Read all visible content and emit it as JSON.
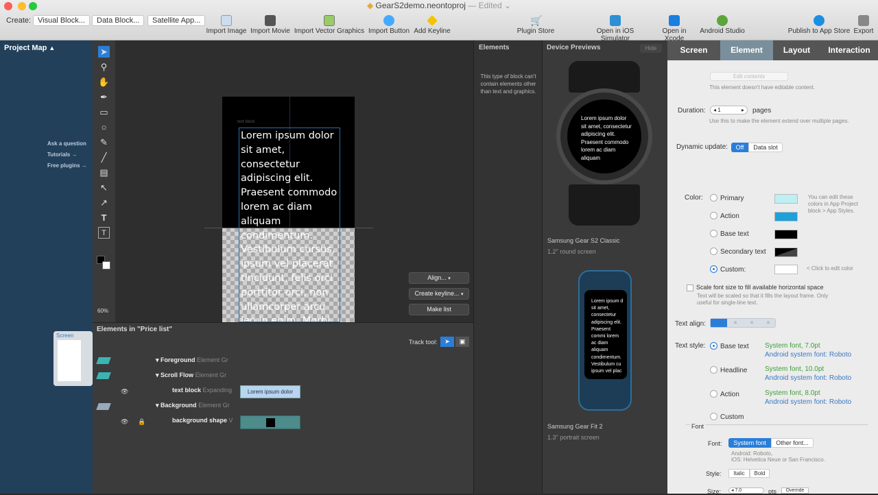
{
  "window": {
    "title": "GearS2demo.neontoproj",
    "edited": "— Edited ⌄"
  },
  "toolbar": {
    "create_label": "Create:",
    "buttons": [
      "Visual Block...",
      "Data Block...",
      "Satellite App..."
    ],
    "tools": [
      {
        "label": "Import Image",
        "icon": "image-icon"
      },
      {
        "label": "Import Movie",
        "icon": "movie-icon"
      },
      {
        "label": "Import Vector Graphics",
        "icon": "vector-icon"
      },
      {
        "label": "Import Button",
        "icon": "button-icon"
      },
      {
        "label": "Add Keyline",
        "icon": "keyline-icon"
      },
      {
        "label": "Plugin Store",
        "icon": "cart-icon"
      },
      {
        "label": "Open in iOS Simulator",
        "icon": "simulator-icon"
      },
      {
        "label": "Open in Xcode",
        "icon": "xcode-icon"
      },
      {
        "label": "Android Studio",
        "icon": "android-icon"
      },
      {
        "label": "Publish to App Store",
        "icon": "appstore-icon"
      },
      {
        "label": "Export",
        "icon": "export-icon"
      }
    ]
  },
  "project_map": {
    "title": "Project Map",
    "links": [
      "Ask a question",
      "Tutorials →",
      "Free plugins →"
    ],
    "screen_label": "Screen"
  },
  "canvas": {
    "zoom": "60%",
    "block_label": "text block",
    "lorem": "Lorem ipsum dolor sit amet, consectetur adipiscing elit. Praesent commodo lorem ac diam aliquam condimentum. Vestibulum cursus, ipsum vel placerat tincidunt, felis orci porttitor orci, non ullamcorper arcu leo in enim. Morbi",
    "align_btn": "Align...",
    "keyline_btn": "Create keyline...",
    "makelist_btn": "Make list"
  },
  "elements_list": {
    "title": "Elements in \"Price list\"",
    "track_tool": "Track tool:",
    "rows": [
      {
        "name": "Foreground",
        "type": "Element Gr"
      },
      {
        "name": "Scroll Flow",
        "type": "Element Gr"
      },
      {
        "name": "text block",
        "type": "Expanding",
        "preview": "Lorem ipsum dolor"
      },
      {
        "name": "Background",
        "type": "Element Gr"
      },
      {
        "name": "background shape",
        "type": "V"
      }
    ]
  },
  "elements_panel": {
    "title": "Elements",
    "note": "This type of block can't contain elements other than text and graphics."
  },
  "device_previews": {
    "title": "Device Previews",
    "hide": "Hide",
    "watch_text": "Lorem ipsum dolor sit amet, consectetur adipiscing elit. Praesent commodo lorem ac diam aliquam",
    "band_text": "Lorem ipsum d sit amet, consectetur adipiscing elit. Praesent commi lorem ac diam aliquam condimentum. Vestibulum cu ipsum vel plac",
    "devices": [
      {
        "name": "Samsung Gear S2 Classic",
        "desc": "1.2\" round screen"
      },
      {
        "name": "Samsung Gear Fit 2",
        "desc": "1.3\" portrait screen"
      }
    ]
  },
  "properties": {
    "tabs": [
      "Screen",
      "Element",
      "Layout",
      "Interaction"
    ],
    "edit_contents": "Edit contents",
    "edit_note": "This element doesn't have editable content.",
    "duration_label": "Duration:",
    "duration_value": "1",
    "duration_unit": "pages",
    "duration_note": "Use this to make the element extend over multiple pages.",
    "dynamic_label": "Dynamic update:",
    "dyn_off": "Off",
    "dyn_slot": "Data slot",
    "color_label": "Color:",
    "colors": [
      {
        "name": "Primary",
        "hex": "#bfeff2"
      },
      {
        "name": "Action",
        "hex": "#1ea0d8"
      },
      {
        "name": "Base text",
        "hex": "#000000"
      },
      {
        "name": "Secondary text",
        "hex": "#222222"
      },
      {
        "name": "Custom:",
        "hex": "#ffffff"
      }
    ],
    "color_note": "You can edit these colors in App Project block > App Styles.",
    "click_edit": "< Click to edit color",
    "scale_label": "Scale font size to fill available horizontal space",
    "scale_note": "Text will be scaled so that it fills the layout frame. Only useful for single-line text.",
    "align_label": "Text align:",
    "style_label": "Text style:",
    "styles": [
      {
        "name": "Base text",
        "sys": "System font,  7.0pt",
        "android": "Android system font: Roboto"
      },
      {
        "name": "Headline",
        "sys": "System font,  10.0pt",
        "android": "Android system font: Roboto"
      },
      {
        "name": "Action",
        "sys": "System font,  8.0pt",
        "android": "Android system font: Roboto"
      },
      {
        "name": "Custom",
        "sys": "",
        "android": ""
      }
    ],
    "font_section": "Font",
    "font_label": "Font:",
    "font_sys": "System font",
    "font_other": "Other font...",
    "font_note1": "Android: Roboto,",
    "font_note2": "iOS: Helvetica Neue or San Francisco.",
    "fstyle_label": "Style:",
    "italic": "Italic",
    "bold": "Bold",
    "size_label": "Size:",
    "size_value": "7.0",
    "size_unit": "pts",
    "override": "Override"
  }
}
